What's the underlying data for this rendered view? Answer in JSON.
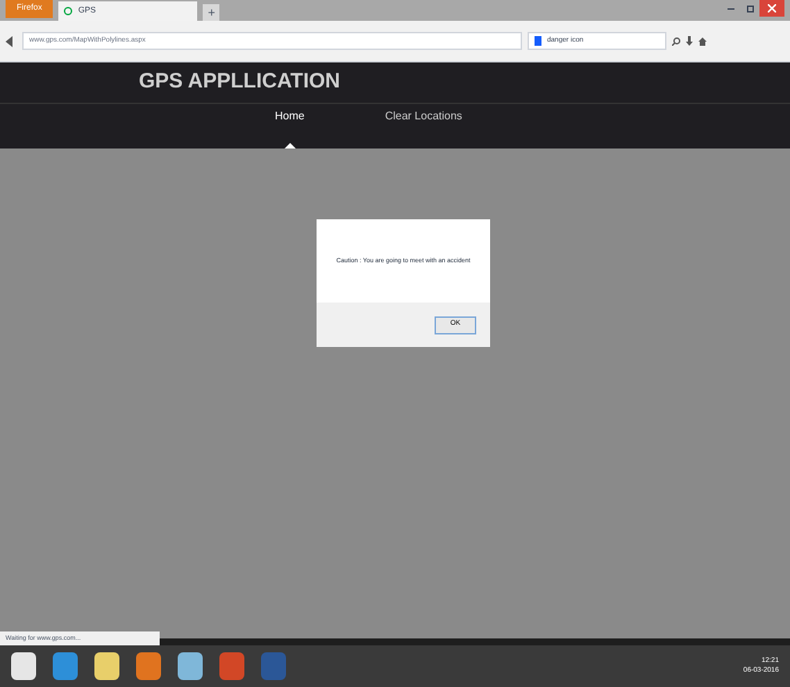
{
  "browser": {
    "menu_button": "Firefox",
    "tabs": [
      {
        "label": "GPS",
        "selected": true
      }
    ],
    "new_tab": "+",
    "address": "www.gps.com/MapWithPolylines.aspx",
    "search_value": "danger icon"
  },
  "app": {
    "title": "GPS APPLLICATION",
    "nav": [
      {
        "label": "Home",
        "selected": true
      },
      {
        "label": "Clear Locations",
        "selected": false
      }
    ]
  },
  "dialog": {
    "message": "Caution : You are going to meet with an accident",
    "button": "OK"
  },
  "status_bar": "Waiting for www.gps.com...",
  "taskbar": {
    "time": "12:21",
    "date": "06-03-2016"
  }
}
